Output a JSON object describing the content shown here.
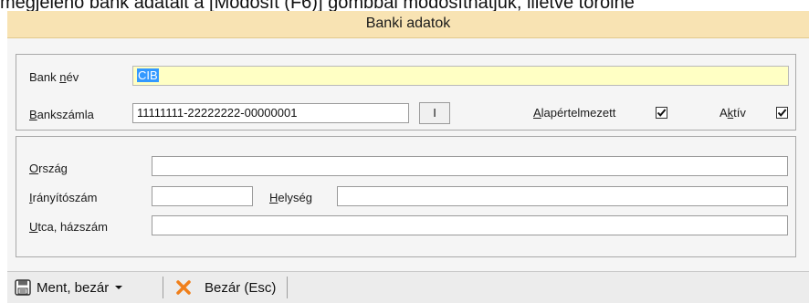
{
  "doc": {
    "text": "megjelenő bank adatait a [Módosít (F6)] gombbal módosíthatjuk, illetve törölhe"
  },
  "window": {
    "title": "Banki adatok"
  },
  "bank": {
    "name_label_pre": "Bank ",
    "name_label_u": "n",
    "name_label_post": "év",
    "name_value": "CIB",
    "account_label_u": "B",
    "account_label_post": "ankszámla",
    "account_value": "11111111-22222222-00000001",
    "lookup_btn": "I",
    "default_label_u": "A",
    "default_label_post": "lapértelmezett",
    "default_checked": true,
    "active_label_pre": "A",
    "active_label_u": "k",
    "active_label_post": "tív",
    "active_checked": true
  },
  "address": {
    "country_label_u": "O",
    "country_label_post": "rszág",
    "country_value": "",
    "zip_label_u": "I",
    "zip_label_post": "rányítószám",
    "zip_value": "",
    "city_label_u": "H",
    "city_label_post": "elység",
    "city_value": "",
    "street_label_u": "U",
    "street_label_post": "tca, házszám",
    "street_value": ""
  },
  "toolbar": {
    "save_label": "Ment, bezár",
    "close_label": "Bezár (Esc)"
  }
}
